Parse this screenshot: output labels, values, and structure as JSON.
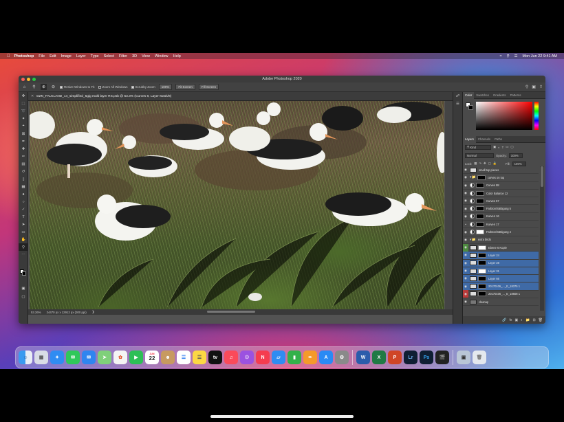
{
  "menubar": {
    "app": "Photoshop",
    "items": [
      "File",
      "Edit",
      "Image",
      "Layer",
      "Type",
      "Select",
      "Filter",
      "3D",
      "View",
      "Window",
      "Help"
    ],
    "datetime": "Mon Jun 22  9:41 AM"
  },
  "window": {
    "title": "Adobe Photoshop 2020"
  },
  "options": {
    "resize": "Resize Windows to Fit",
    "zoom_all": "Zoom All Windows",
    "scrubby": "Scrubby Zoom",
    "zoom_level": "100%",
    "fit_screen": "Fit Screen",
    "fill_screen": "Fill Screen"
  },
  "document": {
    "tab": "DZN_FALKLAND_14_simplified_5gig multi layer RS.psb @ 53.3% (Curves 8, Layer Mask/8)",
    "status_zoom": "53.26%",
    "status_dims": "24470 px x 12912 px (300 ppi)"
  },
  "color_panel": {
    "tabs": [
      "Color",
      "Swatches",
      "Gradients",
      "Patterns"
    ]
  },
  "layers_panel": {
    "tabs": [
      "Layers",
      "Channels",
      "Paths"
    ],
    "kind": "Kind",
    "blend": "Normal",
    "opacity_label": "Opacity:",
    "opacity": "100%",
    "lock_label": "Lock:",
    "fill_label": "Fill:",
    "fill": "100%",
    "layers": [
      {
        "name": "small top pieces",
        "type": "pixel"
      },
      {
        "name": "curves on top",
        "type": "group"
      },
      {
        "name": "Curves 88",
        "type": "adj"
      },
      {
        "name": "Color Balance 12",
        "type": "adj"
      },
      {
        "name": "Curves 57",
        "type": "adj"
      },
      {
        "name": "Farbton/Sättigung 5",
        "type": "adj"
      },
      {
        "name": "Kurven 16",
        "type": "adj"
      },
      {
        "name": "Kurven 17",
        "type": "adj"
      },
      {
        "name": "Farbton/Sättigung 4",
        "type": "adj"
      },
      {
        "name": "extra birds",
        "type": "group"
      },
      {
        "name": "Ebene 6 Kopie",
        "type": "pixel"
      },
      {
        "name": "Layer 24",
        "type": "pixel"
      },
      {
        "name": "Layer 28",
        "type": "pixel"
      },
      {
        "name": "Layer 31",
        "type": "pixel"
      },
      {
        "name": "Layer 66",
        "type": "pixel"
      },
      {
        "name": "20170106_..._E_18375 1",
        "type": "pixel"
      },
      {
        "name": "20170106_..._E_18608 1",
        "type": "pixel"
      },
      {
        "name": "cleanup",
        "type": "pixel"
      }
    ]
  },
  "dock": {
    "calendar_month": "JUN",
    "calendar_day": "22",
    "apps": [
      "Finder",
      "Launchpad",
      "Safari",
      "Messages",
      "Mail",
      "Maps",
      "Photos",
      "FaceTime",
      "Calendar",
      "Contacts",
      "Reminders",
      "Notes",
      "TV",
      "Music",
      "Podcasts",
      "News",
      "Keynote",
      "Numbers",
      "Pages",
      "App Store",
      "System Preferences",
      "Word",
      "Excel",
      "PowerPoint",
      "Lightroom",
      "Photoshop",
      "Final Cut Pro",
      "Preview",
      "Trash"
    ],
    "labels": {
      "word": "W",
      "excel": "X",
      "powerpoint": "P",
      "lightroom": "Lr",
      "photoshop": "Ps"
    }
  }
}
